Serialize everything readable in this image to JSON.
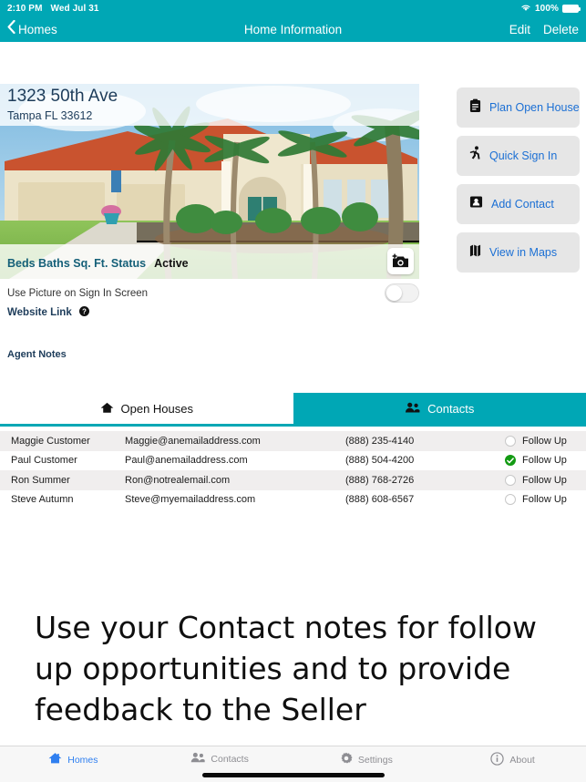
{
  "status_bar": {
    "time": "2:10 PM",
    "date": "Wed Jul 31",
    "battery_pct": "100%",
    "wifi_icon": "wifi-icon",
    "battery_icon": "battery-full-icon"
  },
  "nav_bar": {
    "back_label": "Homes",
    "back_icon": "chevron-left-icon",
    "title": "Home Information",
    "edit_label": "Edit",
    "delete_label": "Delete"
  },
  "property": {
    "address_line1": "1323 50th Ave",
    "address_line2": "Tampa FL  33612",
    "camera_icon": "camera-add-icon",
    "specs": [
      {
        "label": "Beds",
        "value": ""
      },
      {
        "label": "Baths",
        "value": ""
      },
      {
        "label": "Sq. Ft.",
        "value": ""
      },
      {
        "label": "Status",
        "value": "Active"
      }
    ],
    "spec_labels": "Beds  Baths  Sq. Ft.  Status",
    "spec_status_value": "Active"
  },
  "actions": [
    {
      "label": "Plan Open House",
      "icon": "clipboard-icon"
    },
    {
      "label": "Quick Sign In",
      "icon": "running-person-icon"
    },
    {
      "label": "Add Contact",
      "icon": "contact-card-icon"
    },
    {
      "label": "View in Maps",
      "icon": "map-icon"
    }
  ],
  "picture_toggle": {
    "label": "Use Picture on Sign In Screen",
    "state": "off"
  },
  "website_link": {
    "label": "Website Link",
    "help_icon": "help-circle-icon"
  },
  "agent_notes_label": "Agent Notes",
  "tabs": [
    {
      "label": "Open Houses",
      "icon": "house-icon",
      "active": false
    },
    {
      "label": "Contacts",
      "icon": "people-icon",
      "active": true
    }
  ],
  "contacts": [
    {
      "name": "Maggie  Customer",
      "email": "Maggie@anemailaddress.com",
      "phone": "(888) 235-4140",
      "follow_up_label": "Follow Up",
      "follow_up": false
    },
    {
      "name": "Paul Customer",
      "email": "Paul@anemailaddress.com",
      "phone": "(888) 504-4200",
      "follow_up_label": "Follow Up",
      "follow_up": true
    },
    {
      "name": "Ron Summer",
      "email": "Ron@notrealemail.com",
      "phone": "(888) 768-2726",
      "follow_up_label": "Follow Up",
      "follow_up": false
    },
    {
      "name": "Steve Autumn",
      "email": "Steve@myemailaddress.com",
      "phone": "(888) 608-6567",
      "follow_up_label": "Follow Up",
      "follow_up": false
    }
  ],
  "promo_text": "Use your Contact notes for follow up opportunities and to provide feedback to the Seller",
  "bottom_tabs": [
    {
      "label": "Homes",
      "icon": "home-icon",
      "active": true
    },
    {
      "label": "Contacts",
      "icon": "people-icon",
      "active": false
    },
    {
      "label": "Settings",
      "icon": "gear-icon",
      "active": false
    },
    {
      "label": "About",
      "icon": "info-icon",
      "active": false
    }
  ],
  "colors": {
    "teal": "#00a7b5",
    "link_blue": "#1b6fd4",
    "active_blue": "#2f7ff0",
    "check_green": "#139a13",
    "row_alt": "#f0eeee",
    "button_gray": "#e6e6e6"
  }
}
